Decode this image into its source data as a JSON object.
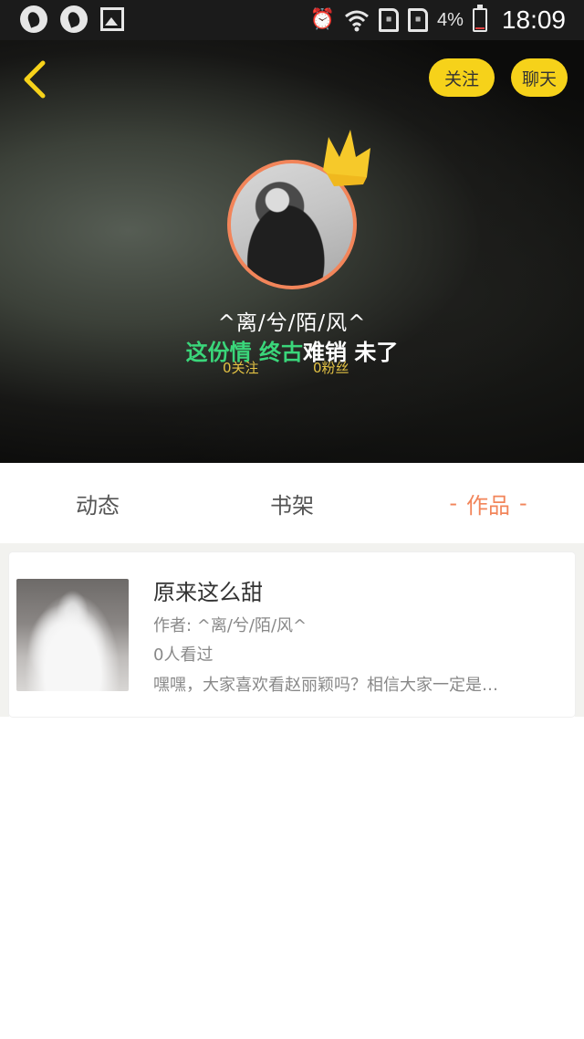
{
  "status_bar": {
    "battery": "4%",
    "time": "18:09",
    "left_icons": [
      "app-icon",
      "app-icon",
      "gallery-icon"
    ],
    "right_icons": [
      "alarm-icon",
      "wifi-icon",
      "sim-icon",
      "sim-icon",
      "battery-charging-icon"
    ]
  },
  "header": {
    "follow_label": "关注",
    "chat_label": "聊天",
    "accent": "#f6d21a"
  },
  "profile": {
    "nickname": "^离/兮/陌/风^",
    "signature_green": "这份情 终古",
    "signature_white": "难销 未了",
    "following": "0关注",
    "followers": "0粉丝"
  },
  "tabs": [
    {
      "label": "动态",
      "active": false
    },
    {
      "label": "书架",
      "active": false
    },
    {
      "label": "作品",
      "active": true
    }
  ],
  "tab_dash": "-",
  "works": [
    {
      "title": "原来这么甜",
      "author": "作者: ^离/兮/陌/风^",
      "views": "0人看过",
      "description": "嘿嘿，大家喜欢看赵丽颖吗？相信大家一定是…"
    }
  ],
  "colors": {
    "active_tab": "#f2855a",
    "signature_green": "#3ad67a",
    "stats": "#e3c244"
  }
}
